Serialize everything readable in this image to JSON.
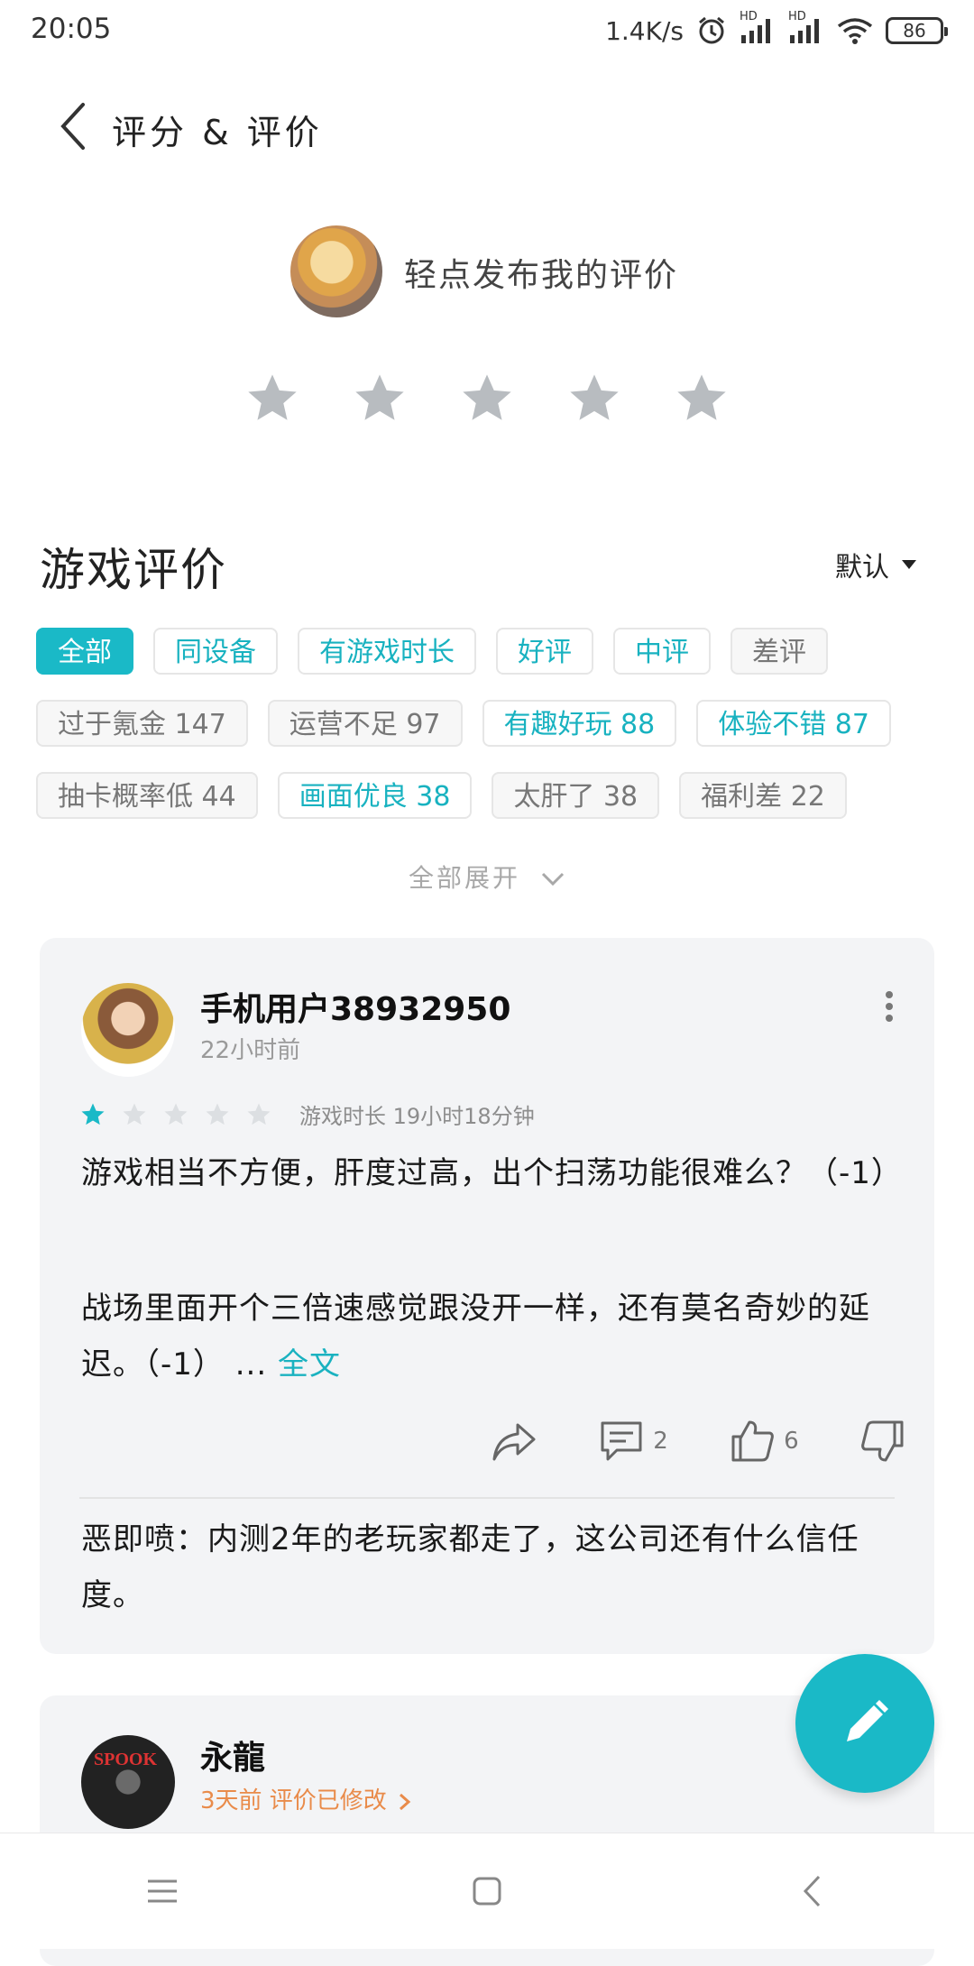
{
  "status": {
    "time": "20:05",
    "net_speed": "1.4K/s",
    "signal1": "HD",
    "signal2": "HD",
    "battery": "86",
    "icons": [
      "alarm-icon",
      "signal-icon",
      "wifi-icon",
      "battery-icon"
    ]
  },
  "header": {
    "title": "评分 & 评价",
    "back_icon": "chevron-left-icon"
  },
  "my_review": {
    "prompt": "轻点发布我的评价",
    "rating_max": 5,
    "rating_value": 0
  },
  "reviews_section": {
    "title": "游戏评价",
    "sort_label": "默认",
    "tag_rows": [
      [
        {
          "label": "全部",
          "style": "active"
        },
        {
          "label": "同设备",
          "style": "teal"
        },
        {
          "label": "有游戏时长",
          "style": "teal"
        },
        {
          "label": "好评",
          "style": "teal"
        },
        {
          "label": "中评",
          "style": "teal"
        },
        {
          "label": "差评",
          "style": "neutral"
        }
      ],
      [
        {
          "label": "过于氪金 147",
          "style": "neutral"
        },
        {
          "label": "运营不足 97",
          "style": "neutral"
        },
        {
          "label": "有趣好玩 88",
          "style": "teal"
        },
        {
          "label": "体验不错 87",
          "style": "teal"
        }
      ],
      [
        {
          "label": "抽卡概率低 44",
          "style": "neutral"
        },
        {
          "label": "画面优良 38",
          "style": "teal"
        },
        {
          "label": "太肝了 38",
          "style": "neutral"
        },
        {
          "label": "福利差 22",
          "style": "neutral"
        }
      ]
    ],
    "expand_label": "全部展开"
  },
  "reviews": [
    {
      "username": "手机用户38932950",
      "time": "22小时前",
      "rating": 1,
      "rating_max": 5,
      "playtime": "游戏时长 19小时18分钟",
      "paragraph1": "游戏相当不方便，肝度过高，出个扫荡功能很难么？（-1）",
      "paragraph2": "战场里面开个三倍速感觉跟没开一样，还有莫名奇妙的延迟。（-1） ...",
      "full_text_link": "全文",
      "comments": "2",
      "likes": "6",
      "reply": "恶即喷：内测2年的老玩家都走了，这公司还有什么信任度。"
    },
    {
      "username": "永龍",
      "time": "3天前 评价已修改",
      "avatar_text": "SPOOK"
    }
  ],
  "colors": {
    "accent": "#1ab9c7",
    "star_gray": "#b8bcc0",
    "modified_orange": "#e98b4a"
  }
}
